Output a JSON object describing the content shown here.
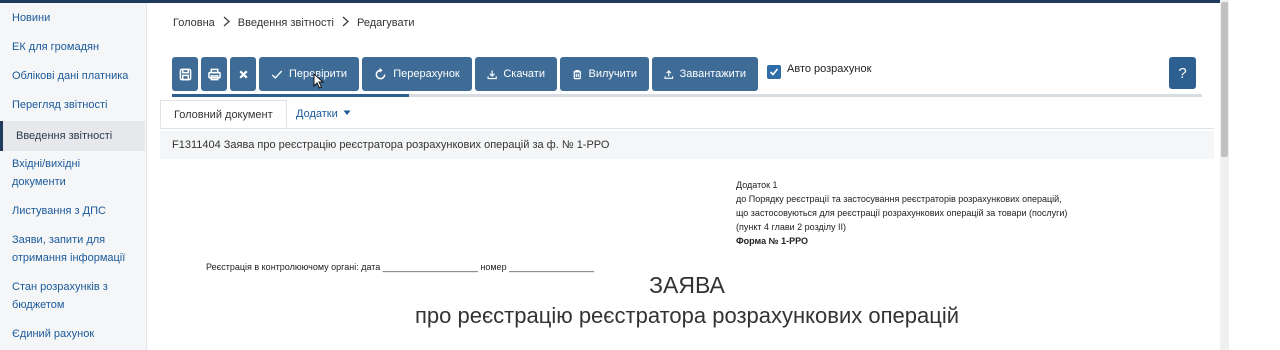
{
  "sidebar": {
    "items": [
      {
        "label": "Новини"
      },
      {
        "label": "ЕК для громадян"
      },
      {
        "label": "Облікові дані платника"
      },
      {
        "label": "Перегляд звітності"
      },
      {
        "label": "Введення звітності"
      },
      {
        "label": "Вхідні/вихідні"
      },
      {
        "label": "документи"
      },
      {
        "label": "Листування з ДПС"
      },
      {
        "label": "Заяви, запити для"
      },
      {
        "label": "отримання інформації"
      },
      {
        "label": "Стан розрахунків з"
      },
      {
        "label": "бюджетом"
      },
      {
        "label": "Єдиний рахунок"
      }
    ],
    "active_index": 4
  },
  "breadcrumb": [
    "Головна",
    "Введення звітності",
    "Редагувати"
  ],
  "toolbar": {
    "verify": "Перевірити",
    "recalc": "Перерахунок",
    "download": "Скачати",
    "delete": "Вилучити",
    "upload": "Завантажити",
    "auto_calc": "Авто розрахунок",
    "auto_calc_checked": true,
    "help": "?"
  },
  "progress_fraction": 0.23,
  "tabs": {
    "main": "Головний документ",
    "attachments": "Додатки"
  },
  "document": {
    "form_header": "F1311404 Заява про реєстрацію реєстратора розрахункових операцій за ф. № 1-РРО",
    "appendix_lines": [
      "Додаток 1",
      "до Порядку реєстрації та застосування реєстраторів розрахункових операцій,",
      "що застосовуються для реєстрації розрахункових операцій за товари (послуги)",
      "(пункт 4 глави 2 розділу ІІ)"
    ],
    "form_number": "Форма № 1-РРО",
    "registration_line": "Реєстрація в контролюючому органі: дата ___________________ номер _________________",
    "title": "ЗАЯВА",
    "subtitle": "про реєстрацію реєстратора розрахункових операцій"
  },
  "colors": {
    "accent": "#3e6c96",
    "help": "#2d5f90",
    "link": "#1a5a9a"
  }
}
